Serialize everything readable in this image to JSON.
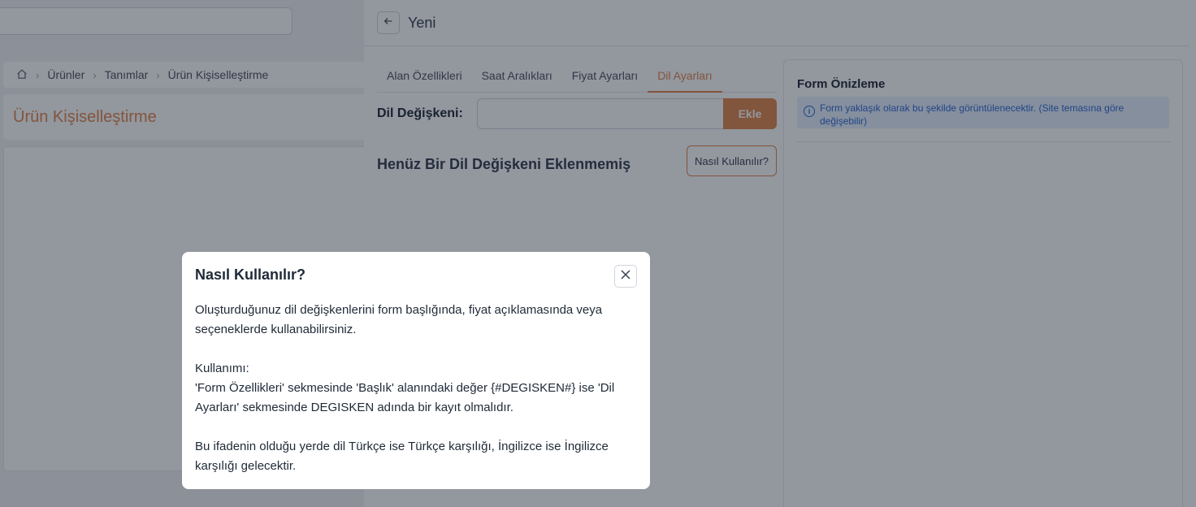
{
  "background": {
    "breadcrumb": [
      "Ürünler",
      "Tanımlar",
      "Ürün Kişiselleştirme"
    ],
    "page_title": "Ürün Kişiselleştirme"
  },
  "drawer": {
    "title": "Yeni",
    "tabs": [
      {
        "label": "Alan Özellikleri",
        "active": false
      },
      {
        "label": "Saat Aralıkları",
        "active": false
      },
      {
        "label": "Fiyat Ayarları",
        "active": false
      },
      {
        "label": "Dil Ayarları",
        "active": true
      }
    ],
    "field_label": "Dil Değişkeni:",
    "field_value": "",
    "add_button": "Ekle",
    "empty_title": "Henüz Bir Dil Değişkeni Eklenmemiş",
    "help_button": "Nasıl Kullanılır?",
    "preview": {
      "title": "Form Önizleme",
      "info": "Form yaklaşık olarak bu şekilde görüntülenecektir. (Site temasına göre değişebilir)"
    }
  },
  "modal": {
    "title": "Nasıl Kullanılır?",
    "paragraph1": "Oluşturduğunuz dil değişkenlerini form başlığında, fiyat açıklamasında veya seçeneklerde kullanabilirsiniz.",
    "paragraph2_heading": "Kullanımı:",
    "paragraph2_body": "'Form Özellikleri' sekmesinde 'Başlık' alanındaki değer {#DEGISKEN#} ise 'Dil Ayarları' sekmesinde DEGISKEN adında bir kayıt olmalıdır.",
    "paragraph3": "Bu ifadenin olduğu yerde dil Türkçe ise Türkçe karşılığı, İngilizce ise İngilizce karşılığı gelecektir."
  },
  "icons": {
    "home": "home-icon",
    "back": "arrow-left-icon",
    "close": "close-icon",
    "info": "info-icon"
  },
  "colors": {
    "accent": "#e0874f",
    "info_text": "#2d6ad8",
    "info_bg": "#e8f0fd"
  }
}
